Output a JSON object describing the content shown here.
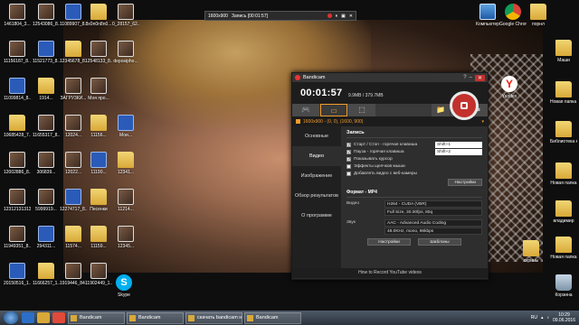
{
  "recording_bar": {
    "resolution": "1600x900",
    "status": "Запись [00:01:57]"
  },
  "window": {
    "title": "Bandicam",
    "timer": "00:01:57",
    "size": "9.9MB / 379.7MB",
    "target": "1600x900 - (0, 0), (1600, 900)",
    "modes": [
      "🎮",
      "▭",
      "⬚",
      "📁",
      "📷",
      "⏸"
    ],
    "sidebar": [
      "Основные",
      "Видео",
      "Изображение",
      "Обзор результатов",
      "О программе"
    ],
    "active_tab": "Видео",
    "section": "Запись",
    "options": [
      {
        "label": "Старт / Стоп - горячая клавиша",
        "checked": true,
        "hotkey": "Shift+1"
      },
      {
        "label": "Пауза - горячая клавиша",
        "checked": true,
        "hotkey": "Shift+2"
      },
      {
        "label": "Показывать курсор",
        "checked": true,
        "hotkey": ""
      },
      {
        "label": "Эффекты щелчков мыши",
        "checked": false,
        "hotkey": ""
      },
      {
        "label": "Добавлять видео с веб-камеры",
        "checked": false,
        "hotkey": ""
      }
    ],
    "settings_btn": "Настройки",
    "format_head": "Формат - MP4",
    "video_label": "Видео",
    "video_vals": [
      "H264 - CUDA (VBR)",
      "Full Size, 30.00fps, 80q"
    ],
    "audio_label": "Звук",
    "audio_vals": [
      "AAC - Advanced Audio Coding",
      "48.0KHz, mono, 96kbps"
    ],
    "format_settings_btn": "Настройки",
    "templates_btn": "Шаблоны",
    "footer": "How to Record YouTube videos"
  },
  "desktop_left": [
    [
      "1461804_3...",
      "12543086_8...",
      "11089907_8...",
      "8x0n0n8n0...",
      "0_28157_62..."
    ],
    [
      "11156187_8...",
      "11521773_8...",
      "12345678_8...",
      "12548133_8...",
      "deposipho..."
    ],
    [
      "11099814_8...",
      "1914...",
      "ЗАГРУ3КИ...",
      "Моя про...",
      ""
    ],
    [
      "10685428_7...",
      "11655317_8...",
      "12024...",
      "11156...",
      "Мои..."
    ],
    [
      "12002886_8...",
      "306839...",
      "12022...",
      "11190...",
      "12341..."
    ],
    [
      "12312131313",
      "5999919...",
      "12274717_8...",
      "Песенки",
      "11214..."
    ],
    [
      "11949351_8...",
      "294311...",
      "11574...",
      "11159...",
      "12345..."
    ],
    [
      "20150516_1...",
      "11666257_1...",
      "1919446_84...",
      "11902449_1...",
      ""
    ]
  ],
  "desktop_right": [
    "Компьютер",
    "Google Chrome",
    "порнл",
    "Маши",
    "Yandex",
    "Новая папка (2)",
    "Библиотека Archi-Cad ...",
    "Новая папка",
    "владимир",
    "Новая папка",
    "скрины",
    "Корзина"
  ],
  "skype_label": "Skype",
  "taskbar": {
    "tasks": [
      "Bandicam",
      "Bandicam",
      "скачать bandicam н...",
      "Bandicam"
    ],
    "lang": "RU",
    "time": "10:29",
    "date": "09.06.2016"
  }
}
